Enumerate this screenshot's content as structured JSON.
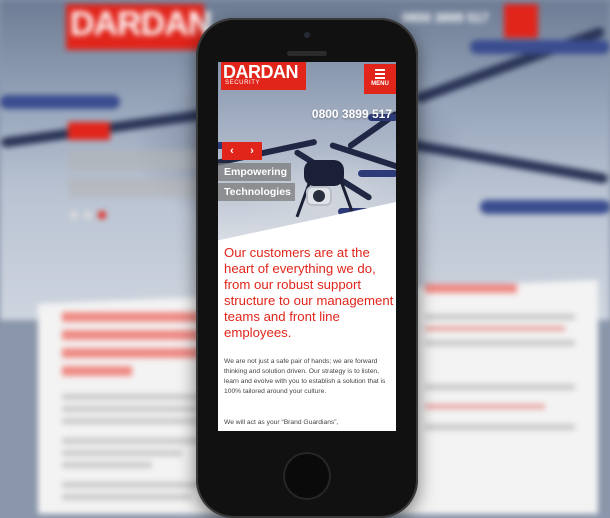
{
  "brand": {
    "name": "DARDAN",
    "sub": "SECURITY",
    "accent_color": "#e1251b"
  },
  "header": {
    "menu_label": "MENU",
    "menu_icon": "hamburger-icon",
    "phone": "0800 3899 517"
  },
  "hero": {
    "prev_icon": "chevron-left-icon",
    "next_icon": "chevron-right-icon",
    "prev_glyph": "‹",
    "next_glyph": "›",
    "tagline_1": "Empowering",
    "tagline_2": "Technologies"
  },
  "content": {
    "lead": "Our customers are at the heart of everything we do, from our robust support structure to our management teams and front line employees.",
    "paragraph_1": "We are not just a safe pair of hands; we are forward thinking and solution driven. Our strategy is to listen, learn and evolve with you to establish a solution that is 100% tailored around your culture.",
    "paragraph_2": "We will act as your “Brand Guardians”,"
  },
  "background_site": {
    "logo": "DARDAN",
    "phone": "0800 3899 517",
    "latest_news": "Latest news"
  }
}
